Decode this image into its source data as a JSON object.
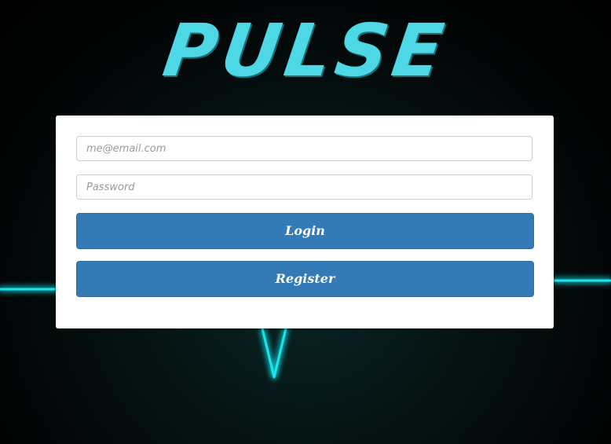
{
  "app": {
    "logo_text": "PULSE"
  },
  "login_form": {
    "email_placeholder": "me@email.com",
    "email_value": "",
    "password_placeholder": "Password",
    "password_value": "",
    "login_label": "Login",
    "register_label": "Register"
  },
  "colors": {
    "logo": "#4ed8e6",
    "button": "#337ab7",
    "pulse_line": "#18e6ee"
  },
  "icons": {
    "background": "heartbeat-pulse-line-icon"
  }
}
